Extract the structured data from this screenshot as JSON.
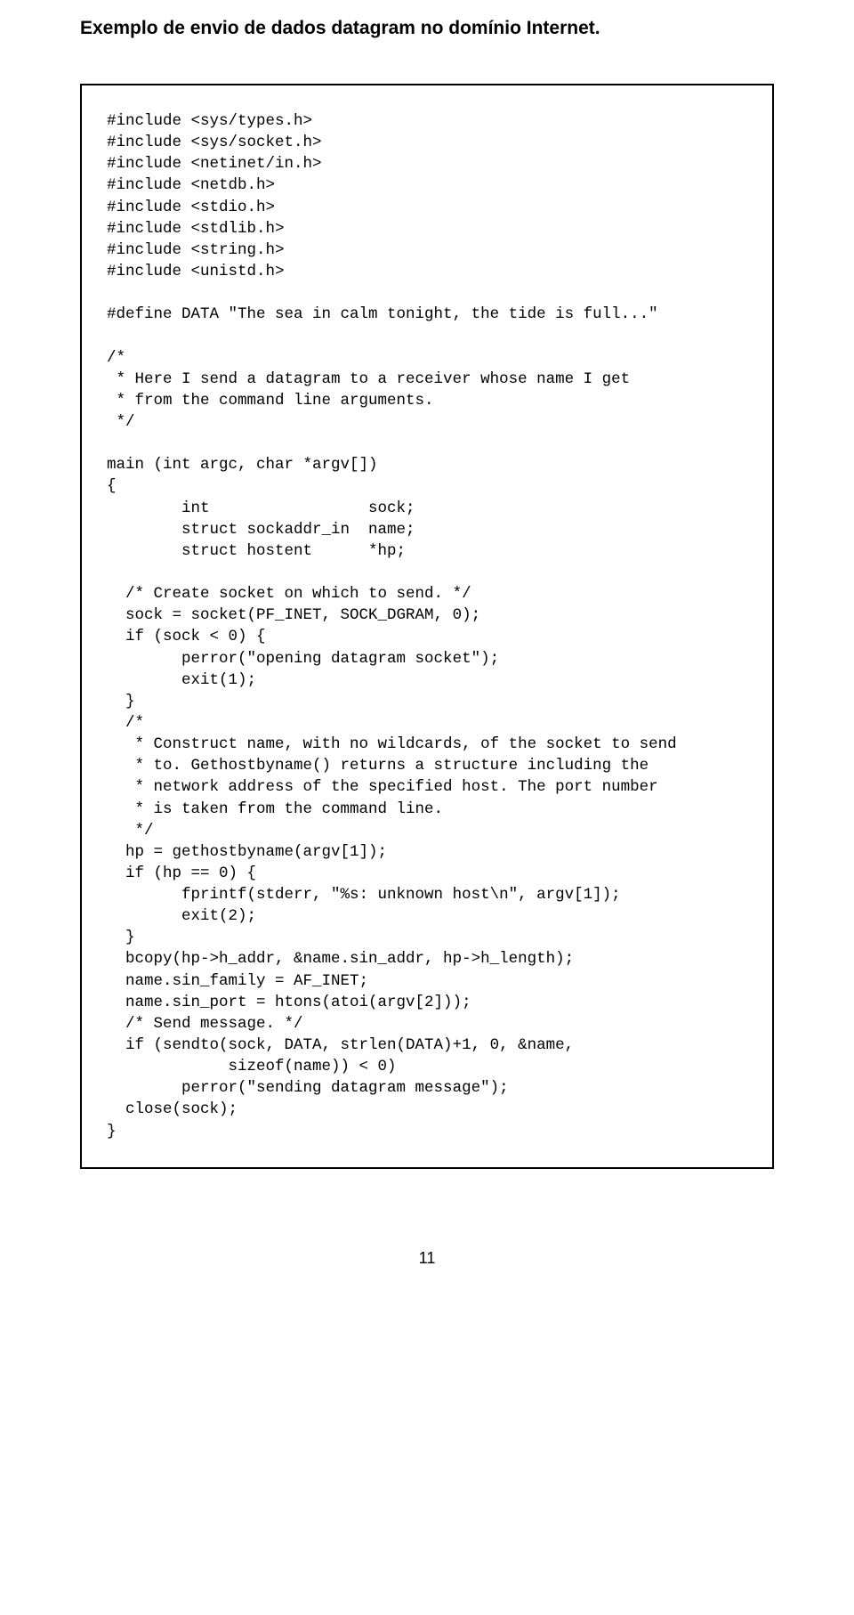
{
  "heading": "Exemplo de envio de dados datagram no domínio Internet.",
  "code": "#include <sys/types.h>\n#include <sys/socket.h>\n#include <netinet/in.h>\n#include <netdb.h>\n#include <stdio.h>\n#include <stdlib.h>\n#include <string.h>\n#include <unistd.h>\n\n#define DATA \"The sea in calm tonight, the tide is full...\"\n\n/*\n * Here I send a datagram to a receiver whose name I get\n * from the command line arguments.\n */\n\nmain (int argc, char *argv[])\n{\n        int                 sock;\n        struct sockaddr_in  name;\n        struct hostent      *hp;\n\n  /* Create socket on which to send. */\n  sock = socket(PF_INET, SOCK_DGRAM, 0);\n  if (sock < 0) {\n        perror(\"opening datagram socket\");\n        exit(1);\n  }\n  /*\n   * Construct name, with no wildcards, of the socket to send\n   * to. Gethostbyname() returns a structure including the\n   * network address of the specified host. The port number\n   * is taken from the command line.\n   */\n  hp = gethostbyname(argv[1]);\n  if (hp == 0) {\n        fprintf(stderr, \"%s: unknown host\\n\", argv[1]);\n        exit(2);\n  }\n  bcopy(hp->h_addr, &name.sin_addr, hp->h_length);\n  name.sin_family = AF_INET;\n  name.sin_port = htons(atoi(argv[2]));\n  /* Send message. */\n  if (sendto(sock, DATA, strlen(DATA)+1, 0, &name,\n             sizeof(name)) < 0)\n        perror(\"sending datagram message\");\n  close(sock);\n}",
  "pageNumber": "11"
}
